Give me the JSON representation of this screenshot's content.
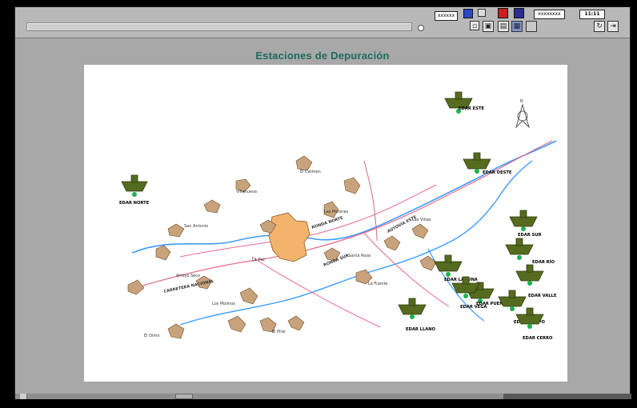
{
  "window": {
    "title": "Estaciones de Depuración"
  },
  "toolbar": {
    "field1": "xxxxxx",
    "field2": "xxxxxxxx",
    "time": "11:11",
    "icons": [
      "monitor-icon",
      "alarm-icon",
      "network-icon",
      "print-icon",
      "document-icon",
      "window-icon",
      "grid-icon",
      "refresh-icon",
      "exit-icon"
    ]
  },
  "map": {
    "legend_north": "N",
    "areas": [
      "San Antonio",
      "Las Moreras",
      "Villanueva",
      "El Carmen",
      "La Paz",
      "Arroyo Seco",
      "Los Molinos",
      "El Pilar",
      "Santa Rosa",
      "La Fuente",
      "Las Viñas",
      "El Olmo"
    ],
    "roads": [
      "RONDA NORTE",
      "RONDA SUR",
      "AUTOVÍA ESTE",
      "CARRETERA NACIONAL"
    ],
    "plants": [
      {
        "name": "EDAR NORTE"
      },
      {
        "name": "EDAR ESTE"
      },
      {
        "name": "EDAR OESTE"
      },
      {
        "name": "EDAR SUR"
      },
      {
        "name": "EDAR RÍO"
      },
      {
        "name": "EDAR VALLE"
      },
      {
        "name": "EDAR LAGUNA"
      },
      {
        "name": "EDAR PUENTE"
      },
      {
        "name": "EDAR CAMPO"
      },
      {
        "name": "EDAR LLANO"
      },
      {
        "name": "EDAR VEGA"
      },
      {
        "name": "EDAR CERRO"
      }
    ]
  },
  "colors": {
    "plant_fill": "#556b1f",
    "plant_dot": "#19b34b",
    "river": "#3c9bff",
    "road_red": "#e86a8a",
    "city": "#f2b36c",
    "town": "#c8a27a"
  }
}
